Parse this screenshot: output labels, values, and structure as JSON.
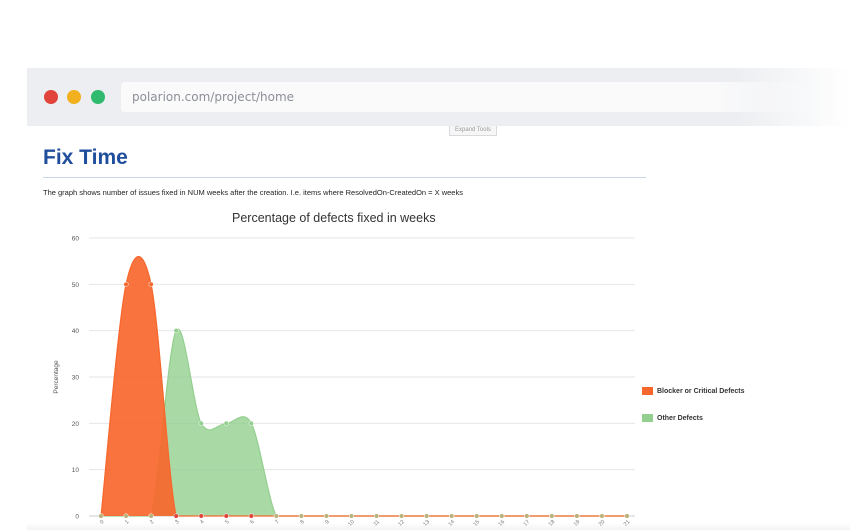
{
  "browser": {
    "url": "polarion.com/project/home",
    "expand_tools_label": "Expand Tools"
  },
  "page": {
    "title": "Fix Time",
    "description": "The graph shows number of issues fixed in NUM weeks after the creation. I.e. items where ResolvedOn-CreatedOn = X weeks"
  },
  "colors": {
    "blocker": "#f7672d",
    "other": "#93cf8f",
    "title_blue": "#1f4e9c"
  },
  "chart_data": {
    "type": "area",
    "title": "Percentage of defects fixed in weeks",
    "ylabel": "Percentage",
    "xlabel": "",
    "ylim": [
      0,
      60
    ],
    "yticks": [
      0,
      10,
      20,
      30,
      40,
      50,
      60
    ],
    "grid": true,
    "legend_position": "right",
    "x": [
      0,
      1,
      2,
      3,
      4,
      5,
      6,
      7,
      8,
      9,
      10,
      11,
      12,
      13,
      14,
      15,
      16,
      17,
      18,
      19,
      20,
      21
    ],
    "series": [
      {
        "name": "Blocker or Critical Defects",
        "values": [
          0,
          50,
          50,
          0,
          0,
          0,
          0,
          0,
          0,
          0,
          0,
          0,
          0,
          0,
          0,
          0,
          0,
          0,
          0,
          0,
          0,
          0
        ]
      },
      {
        "name": "Other Defects",
        "values": [
          0,
          0,
          0,
          40,
          20,
          20,
          20,
          0,
          0,
          0,
          0,
          0,
          0,
          0,
          0,
          0,
          0,
          0,
          0,
          0,
          0,
          0
        ]
      }
    ]
  }
}
